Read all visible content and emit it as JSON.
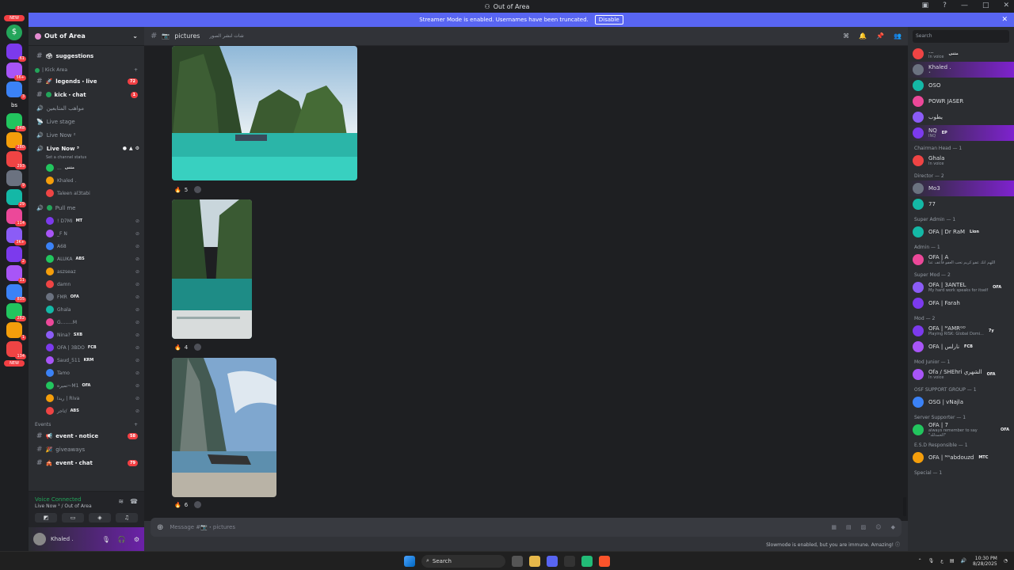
{
  "window": {
    "title": "Out of Area"
  },
  "banner": {
    "text": "Streamer Mode is enabled. Usernames have been truncated.",
    "button": "Disable"
  },
  "guilds": {
    "badges": [
      "61",
      "56+",
      "3",
      "848",
      "280",
      "293",
      "9",
      "29",
      "114",
      "3K+",
      "2",
      "11",
      "835",
      "282",
      "1",
      "134"
    ],
    "bs": "bs",
    "new_top": "NEW",
    "new_bottom": "NEW"
  },
  "server": {
    "name": "Out of Area"
  },
  "channels": {
    "suggestions": "suggestions",
    "cat_kick": "| Kick Area",
    "legends_live": "legends・live",
    "legends_count": "72",
    "kick_chat": "kick・chat",
    "kick_count": "1",
    "arabic_vc": "مواهب المتابعين",
    "live_stage": "Live stage",
    "live_now_1": "Live Now ²",
    "live_now_2": "Live Now ³",
    "set_status": "Set a channel status",
    "pull_me": "Pull me",
    "cat_events": "Events",
    "event_notice": "event・notice",
    "notice_count": "58",
    "giveaways": "giveaways",
    "event_chat": "event・chat",
    "chat_count": "79"
  },
  "voice_users_top": [
    {
      "name": "...",
      "tag": "مثنى"
    },
    {
      "name": "Khaled .",
      "tag": ""
    },
    {
      "name": "Taleen al3tabi",
      "tag": ""
    }
  ],
  "voice_users": [
    {
      "name": "! D7MI",
      "tag": "MT"
    },
    {
      "name": "_F N",
      "tag": ""
    },
    {
      "name": "A68",
      "tag": ""
    },
    {
      "name": "ALUKA",
      "tag": "ABS"
    },
    {
      "name": "aszseaz",
      "tag": ""
    },
    {
      "name": "damn",
      "tag": ""
    },
    {
      "name": "FMR",
      "tag": "OFA"
    },
    {
      "name": "Ghala",
      "tag": ""
    },
    {
      "name": "G........M",
      "tag": ""
    },
    {
      "name": "Nina?",
      "tag": "SXB"
    },
    {
      "name": "OFA | 3BDO",
      "tag": "FCB"
    },
    {
      "name": "Saud_511",
      "tag": "KRM"
    },
    {
      "name": "Tamo",
      "tag": ""
    },
    {
      "name": "تميره~M1",
      "tag": "OFA"
    },
    {
      "name": "ريدا | Riva",
      "tag": ""
    },
    {
      "name": "تاجر/",
      "tag": "ABS"
    }
  ],
  "voice_panel": {
    "status": "Voice Connected",
    "location": "Live Now ³ / Out of Area"
  },
  "user_panel": {
    "name": "Khaled ."
  },
  "channel": {
    "name": "pictures",
    "topic": "شات لنشر الصور",
    "placeholder": "Message #📷・pictures"
  },
  "reactions": [
    {
      "emoji": "🔥",
      "count": "5"
    },
    {
      "emoji": "🔥",
      "count": "4"
    },
    {
      "emoji": "🔥",
      "count": "6"
    }
  ],
  "slowmode": "Slowmode is enabled, but you are immune. Amazing!",
  "members": {
    "search": "Search",
    "top": [
      {
        "name": "...",
        "status": "In voice",
        "tag": "مثنى"
      },
      {
        "name": "Khaled .",
        "status": "•",
        "tag": ""
      },
      {
        "name": "OSO",
        "status": "",
        "tag": ""
      },
      {
        "name": "POWR JASER",
        "status": "",
        "tag": ""
      },
      {
        "name": "يطوب",
        "status": "",
        "tag": ""
      },
      {
        "name": "NQ",
        "status": "INQ",
        "tag": "EP"
      }
    ],
    "roles": [
      {
        "title": "Chairman Head — 1",
        "members": [
          {
            "name": "Ghala",
            "status": "In voice",
            "tag": ""
          }
        ]
      },
      {
        "title": "Director — 2",
        "members": [
          {
            "name": "Mo3",
            "status": "",
            "tag": ""
          },
          {
            "name": "77",
            "status": "",
            "tag": ""
          }
        ]
      },
      {
        "title": "Super Admin — 1",
        "members": [
          {
            "name": "OFA | Dr RaM",
            "status": "",
            "tag": "Lion"
          }
        ]
      },
      {
        "title": "Admin — 1",
        "members": [
          {
            "name": "OFA | A",
            "status": "اللهم انك عفو كريم تحب العفو فاعف عنا",
            "tag": ""
          }
        ]
      },
      {
        "title": "Super Mod — 2",
        "members": [
          {
            "name": "OFA | 3ANTEL",
            "status": "My hard work speaks for itself",
            "tag": "OFA"
          },
          {
            "name": "OFA | Farah",
            "status": "",
            "tag": ""
          }
        ]
      },
      {
        "title": "Mod — 2",
        "members": [
          {
            "name": "OFA | ᴹAMRᴳᴰ",
            "status": "Playing RISK: Global Domi...",
            "tag": "7y"
          },
          {
            "name": "OFA | نارلس",
            "status": "",
            "tag": "FCB"
          }
        ]
      },
      {
        "title": "Mod Junior — 1",
        "members": [
          {
            "name": "Ofa / SHEhri الشهري",
            "status": "In voice",
            "tag": "OFA"
          }
        ]
      },
      {
        "title": "OSF SUPPORT GROUP — 1",
        "members": [
          {
            "name": "OSG | vNajla",
            "status": "",
            "tag": ""
          }
        ]
      },
      {
        "title": "Server Supporter — 1",
        "members": [
          {
            "name": "OFA | 7",
            "status": "always remember to say \"الحمدلله\"",
            "tag": "OFA"
          }
        ]
      },
      {
        "title": "E.S.D Responsible — 1",
        "members": [
          {
            "name": "OFA | ᴹᴬabdouzd",
            "status": "",
            "tag": "MTC"
          }
        ]
      },
      {
        "title": "Special — 1",
        "members": []
      }
    ]
  },
  "taskbar": {
    "search": "Search",
    "time": "10:30 PM",
    "date": "8/28/2025",
    "lang": "ع"
  },
  "colors": {
    "accent": "#5865f2",
    "danger": "#f23f43",
    "online": "#23a55a"
  }
}
